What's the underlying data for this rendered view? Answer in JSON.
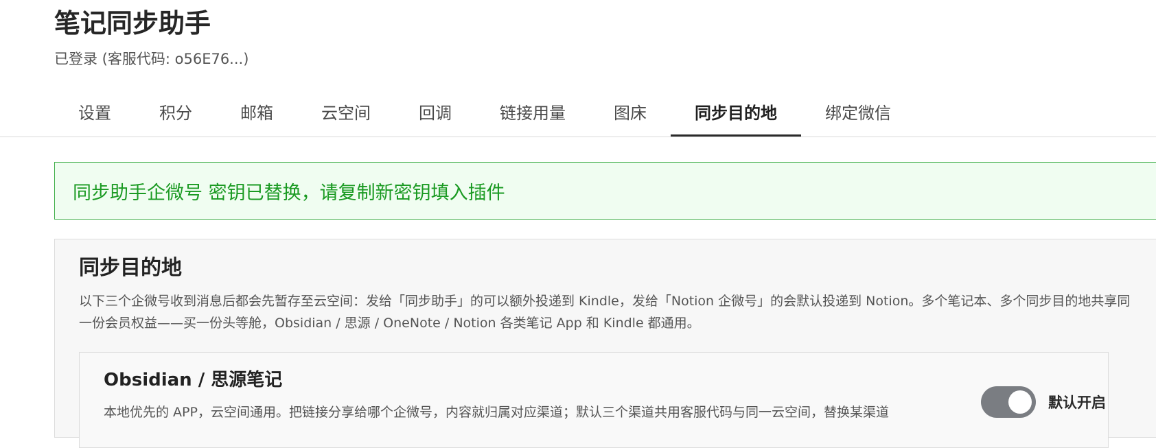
{
  "header": {
    "title": "笔记同步助手",
    "status": "已登录 (客服代码: o56E76...)"
  },
  "tabs": [
    {
      "label": "设置",
      "active": false
    },
    {
      "label": "积分",
      "active": false
    },
    {
      "label": "邮箱",
      "active": false
    },
    {
      "label": "云空间",
      "active": false
    },
    {
      "label": "回调",
      "active": false
    },
    {
      "label": "链接用量",
      "active": false
    },
    {
      "label": "图床",
      "active": false
    },
    {
      "label": "同步目的地",
      "active": true
    },
    {
      "label": "绑定微信",
      "active": false
    }
  ],
  "alert": {
    "message": "同步助手企微号 密钥已替换，请复制新密钥填入插件"
  },
  "panel": {
    "title": "同步目的地",
    "description": "以下三个企微号收到消息后都会先暂存至云空间：发给「同步助手」的可以额外投递到 Kindle，发给「Notion 企微号」的会默认投递到 Notion。多个笔记本、多个同步目的地共享同一份会员权益——买一份头等舱，Obsidian / 思源 / OneNote / Notion 各类笔记 App 和 Kindle 都通用。"
  },
  "card": {
    "title": "Obsidian / 思源笔记",
    "description": "本地优先的 APP，云空间通用。把链接分享给哪个企微号，内容就归属对应渠道；默认三个渠道共用客服代码与同一云空间，替换某渠道",
    "toggle": {
      "label": "默认开启",
      "on": true
    }
  },
  "colors": {
    "alert_text": "#1a9a22",
    "alert_border": "#3fae48",
    "alert_bg": "#f0fdf1",
    "toggle_bg": "#7a7d82"
  }
}
